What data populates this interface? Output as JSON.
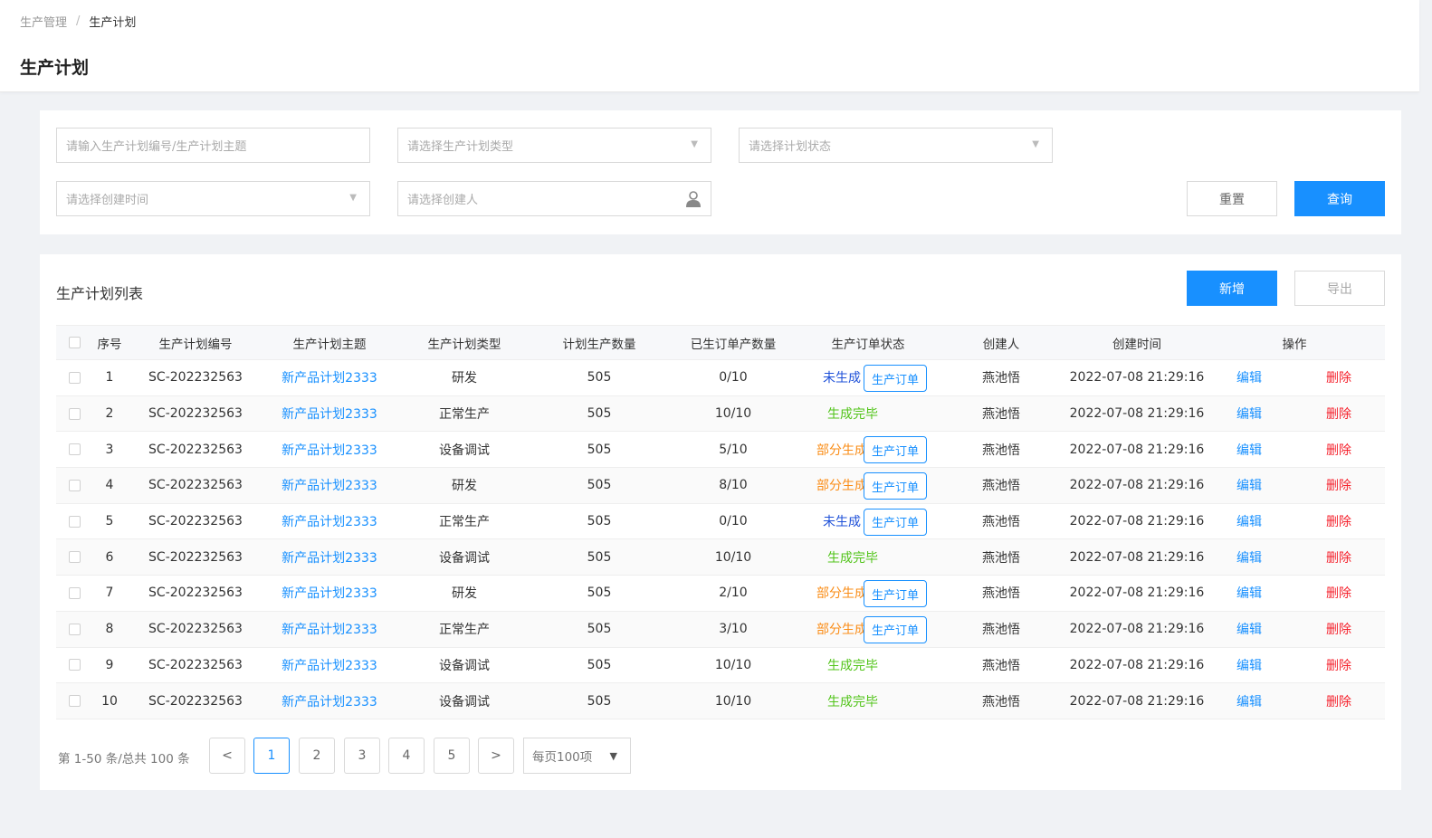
{
  "breadcrumb": {
    "parent": "生产管理",
    "separator": "/",
    "current": "生产计划"
  },
  "page_title": "生产计划",
  "filters": {
    "keyword_placeholder": "请输入生产计划编号/生产计划主题",
    "type_placeholder": "请选择生产计划类型",
    "status_placeholder": "请选择计划状态",
    "created_time_placeholder": "请选择创建时间",
    "creator_placeholder": "请选择创建人",
    "dropdown_icon": "▼",
    "reset_label": "重置",
    "query_label": "查询"
  },
  "list": {
    "title": "生产计划列表",
    "add_label": "新增",
    "export_label": "导出",
    "columns": [
      "序号",
      "生产计划编号",
      "生产计划主题",
      "生产计划类型",
      "计划生产数量",
      "已生订单产数量",
      "生产订单状态",
      "创建人",
      "创建时间",
      "操作"
    ],
    "order_button_label": "生产订单",
    "edit_label": "编辑",
    "delete_label": "删除",
    "rows": [
      {
        "index": "1",
        "code": "SC-202232563",
        "subject": "新产品计划2333",
        "type": "研发",
        "plan_qty": "505",
        "ordered": "0/10",
        "status": "未生成",
        "status_kind": "none",
        "has_order_btn": true,
        "creator": "燕池悟",
        "created": "2022-07-08 21:29:16"
      },
      {
        "index": "2",
        "code": "SC-202232563",
        "subject": "新产品计划2333",
        "type": "正常生产",
        "plan_qty": "505",
        "ordered": "10/10",
        "status": "生成完毕",
        "status_kind": "done",
        "has_order_btn": false,
        "creator": "燕池悟",
        "created": "2022-07-08 21:29:16"
      },
      {
        "index": "3",
        "code": "SC-202232563",
        "subject": "新产品计划2333",
        "type": "设备调试",
        "plan_qty": "505",
        "ordered": "5/10",
        "status": "部分生成",
        "status_kind": "part",
        "has_order_btn": true,
        "creator": "燕池悟",
        "created": "2022-07-08 21:29:16"
      },
      {
        "index": "4",
        "code": "SC-202232563",
        "subject": "新产品计划2333",
        "type": "研发",
        "plan_qty": "505",
        "ordered": "8/10",
        "status": "部分生成",
        "status_kind": "part",
        "has_order_btn": true,
        "creator": "燕池悟",
        "created": "2022-07-08 21:29:16"
      },
      {
        "index": "5",
        "code": "SC-202232563",
        "subject": "新产品计划2333",
        "type": "正常生产",
        "plan_qty": "505",
        "ordered": "0/10",
        "status": "未生成",
        "status_kind": "none",
        "has_order_btn": true,
        "creator": "燕池悟",
        "created": "2022-07-08 21:29:16"
      },
      {
        "index": "6",
        "code": "SC-202232563",
        "subject": "新产品计划2333",
        "type": "设备调试",
        "plan_qty": "505",
        "ordered": "10/10",
        "status": "生成完毕",
        "status_kind": "done",
        "has_order_btn": false,
        "creator": "燕池悟",
        "created": "2022-07-08 21:29:16"
      },
      {
        "index": "7",
        "code": "SC-202232563",
        "subject": "新产品计划2333",
        "type": "研发",
        "plan_qty": "505",
        "ordered": "2/10",
        "status": "部分生成",
        "status_kind": "part",
        "has_order_btn": true,
        "creator": "燕池悟",
        "created": "2022-07-08 21:29:16"
      },
      {
        "index": "8",
        "code": "SC-202232563",
        "subject": "新产品计划2333",
        "type": "正常生产",
        "plan_qty": "505",
        "ordered": "3/10",
        "status": "部分生成",
        "status_kind": "part",
        "has_order_btn": true,
        "creator": "燕池悟",
        "created": "2022-07-08 21:29:16"
      },
      {
        "index": "9",
        "code": "SC-202232563",
        "subject": "新产品计划2333",
        "type": "设备调试",
        "plan_qty": "505",
        "ordered": "10/10",
        "status": "生成完毕",
        "status_kind": "done",
        "has_order_btn": false,
        "creator": "燕池悟",
        "created": "2022-07-08 21:29:16"
      },
      {
        "index": "10",
        "code": "SC-202232563",
        "subject": "新产品计划2333",
        "type": "设备调试",
        "plan_qty": "505",
        "ordered": "10/10",
        "status": "生成完毕",
        "status_kind": "done",
        "has_order_btn": false,
        "creator": "燕池悟",
        "created": "2022-07-08 21:29:16"
      }
    ]
  },
  "pagination": {
    "total_text": "第 1-50 条/总共 100 条",
    "prev": "<",
    "next": ">",
    "pages": [
      "1",
      "2",
      "3",
      "4",
      "5"
    ],
    "current_page": "1",
    "page_size": "每页100项",
    "page_size_icon": "▼"
  },
  "colors": {
    "primary": "#1890ff",
    "danger": "#f5222d",
    "success": "#52c41a",
    "warning": "#fa8c16",
    "not_generated": "#1e50d8"
  },
  "icons": {
    "creator_field": "person-icon",
    "dropdown": "caret-down-icon"
  }
}
